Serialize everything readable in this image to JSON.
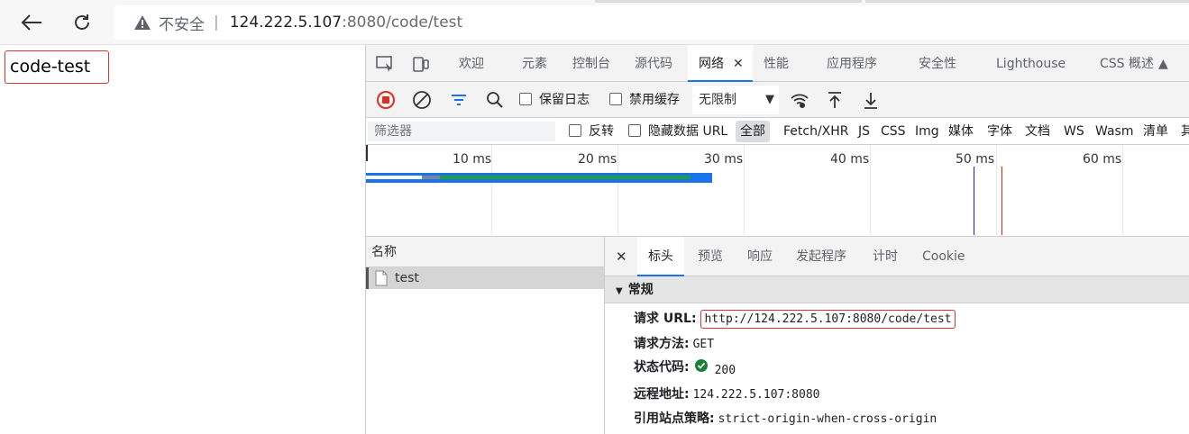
{
  "browser": {
    "insecure_label": "不安全",
    "url_host": "124.222.5.107",
    "url_path": ":8080/code/test"
  },
  "page": {
    "text": "code-test"
  },
  "devtools": {
    "tabs": [
      "欢迎",
      "元素",
      "控制台",
      "源代码",
      "网络",
      "性能",
      "应用程序",
      "安全性",
      "Lighthouse",
      "CSS 概述"
    ],
    "toolbar": {
      "preserve_log": "保留日志",
      "disable_cache": "禁用缓存",
      "throttle": "无限制"
    },
    "filter": {
      "placeholder": "筛选器",
      "invert": "反转",
      "hide_data_urls": "隐藏数据 URL",
      "types": [
        "全部",
        "Fetch/XHR",
        "JS",
        "CSS",
        "Img",
        "媒体",
        "字体",
        "文档",
        "WS",
        "Wasm",
        "清单",
        "其"
      ]
    },
    "timeline_ticks": [
      "10 ms",
      "20 ms",
      "30 ms",
      "40 ms",
      "50 ms",
      "60 ms"
    ],
    "request_list": {
      "header": "名称",
      "rows": [
        "test"
      ]
    },
    "details": {
      "tabs": [
        "标头",
        "预览",
        "响应",
        "发起程序",
        "计时",
        "Cookie"
      ],
      "section": "常规",
      "fields": [
        {
          "key": "请求 URL:",
          "value": "http://124.222.5.107:8080/code/test"
        },
        {
          "key": "请求方法:",
          "value": "GET"
        },
        {
          "key": "状态代码:",
          "value": "200"
        },
        {
          "key": "远程地址:",
          "value": "124.222.5.107:8080"
        },
        {
          "key": "引用站点策略:",
          "value": "strict-origin-when-cross-origin"
        }
      ]
    }
  }
}
